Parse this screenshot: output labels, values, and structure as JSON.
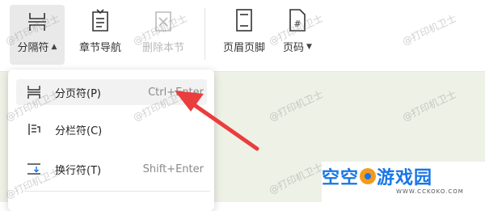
{
  "ribbon": {
    "section_break": "分隔符",
    "chapter_nav": "章节导航",
    "delete_section": "删除本节",
    "header_footer": "页眉页脚",
    "page_number": "页码"
  },
  "menu": {
    "items": [
      {
        "label": "分页符(P)",
        "shortcut": "Ctrl+Enter"
      },
      {
        "label": "分栏符(C)",
        "shortcut": ""
      },
      {
        "label": "换行符(T)",
        "shortcut": "Shift+Enter"
      }
    ]
  },
  "watermark": "@打印机卫士",
  "logo": {
    "main_left": "空空",
    "main_right": "游戏园",
    "sub": "WWW.CCKOKO.COM"
  },
  "colors": {
    "arrow": "#ea3d3d",
    "logo_blue": "#1776e6",
    "logo_orange": "#f39a1e"
  }
}
